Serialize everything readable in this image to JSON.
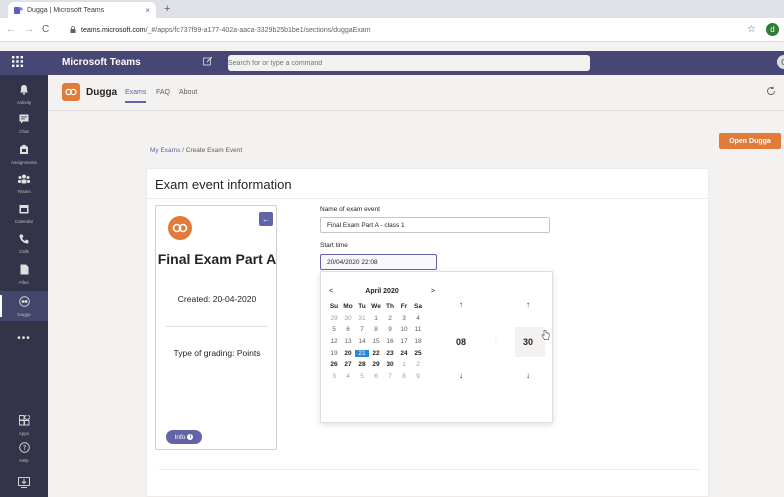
{
  "browser": {
    "tab_title": "Dugga | Microsoft Teams",
    "tab_close": "×",
    "new_tab": "+",
    "back": "←",
    "forward": "→",
    "reload": "C",
    "lock": "🔒",
    "url_host": "teams.microsoft.com",
    "url_path": "/_#/apps/fc737f99-a177-402a-aaca-3329b25b1be1/sections/duggaExam",
    "star": "☆",
    "profile_initial": "d"
  },
  "teams": {
    "app_name": "Microsoft Teams",
    "search_placeholder": "Search for or type a command",
    "user_initial": "C"
  },
  "rail": {
    "items": [
      {
        "label": "Activity",
        "icon": "bell-icon",
        "glyph": "🔔"
      },
      {
        "label": "Chat",
        "icon": "chat-icon",
        "glyph": "▤"
      },
      {
        "label": "Assignments",
        "icon": "assignments-icon",
        "glyph": "▦"
      },
      {
        "label": "Teams",
        "icon": "teams-icon",
        "glyph": "⁂"
      },
      {
        "label": "Calendar",
        "icon": "calendar-icon",
        "glyph": "▣"
      },
      {
        "label": "Calls",
        "icon": "phone-icon",
        "glyph": "✆"
      },
      {
        "label": "Files",
        "icon": "files-icon",
        "glyph": "▮"
      },
      {
        "label": "Dugga",
        "icon": "dugga-icon",
        "glyph": "◉"
      }
    ],
    "more": "•••",
    "apps_label": "Apps",
    "help_label": "Help"
  },
  "app": {
    "name": "Dugga",
    "tabs": [
      "Exams",
      "FAQ",
      "About"
    ],
    "open_button": "Open Dugga"
  },
  "breadcrumb": {
    "link": "My Exams",
    "separator": " / ",
    "current": "Create Exam Event"
  },
  "panel": {
    "title": "Exam event information"
  },
  "card": {
    "title": "Final Exam Part A",
    "created": "Created: 20-04-2020",
    "grading": "Type of grading: Points",
    "info_button": "Info",
    "back_glyph": "←"
  },
  "form": {
    "name_label": "Name of exam event",
    "name_value": "Final Exam Part A - class 1",
    "start_label": "Start time",
    "start_value": "20/04/2020 22:08"
  },
  "calendar": {
    "month": "April 2020",
    "prev": "<",
    "next": ">",
    "dow": [
      "Su",
      "Mo",
      "Tu",
      "We",
      "Th",
      "Fr",
      "Sa"
    ],
    "weeks": [
      [
        {
          "d": "29",
          "m": true
        },
        {
          "d": "30",
          "m": true
        },
        {
          "d": "31",
          "m": true
        },
        {
          "d": "1"
        },
        {
          "d": "2"
        },
        {
          "d": "3"
        },
        {
          "d": "4"
        }
      ],
      [
        {
          "d": "5"
        },
        {
          "d": "6"
        },
        {
          "d": "7"
        },
        {
          "d": "8"
        },
        {
          "d": "9"
        },
        {
          "d": "10"
        },
        {
          "d": "11"
        }
      ],
      [
        {
          "d": "12"
        },
        {
          "d": "13"
        },
        {
          "d": "14"
        },
        {
          "d": "15"
        },
        {
          "d": "16"
        },
        {
          "d": "17"
        },
        {
          "d": "18"
        }
      ],
      [
        {
          "d": "19"
        },
        {
          "d": "20",
          "b": true
        },
        {
          "d": "21",
          "s": true
        },
        {
          "d": "22",
          "b": true
        },
        {
          "d": "23",
          "b": true
        },
        {
          "d": "24",
          "b": true
        },
        {
          "d": "25",
          "b": true
        }
      ],
      [
        {
          "d": "26",
          "b": true
        },
        {
          "d": "27",
          "b": true
        },
        {
          "d": "28",
          "b": true
        },
        {
          "d": "29",
          "b": true
        },
        {
          "d": "30",
          "b": true
        },
        {
          "d": "1",
          "m": true
        },
        {
          "d": "2",
          "m": true
        }
      ],
      [
        {
          "d": "3",
          "m": true
        },
        {
          "d": "4",
          "m": true
        },
        {
          "d": "5",
          "m": true
        },
        {
          "d": "6",
          "m": true
        },
        {
          "d": "7",
          "m": true
        },
        {
          "d": "8",
          "m": true
        },
        {
          "d": "9",
          "m": true
        }
      ]
    ]
  },
  "time": {
    "hour": "08",
    "minute": "30",
    "separator": ":",
    "up": "↑",
    "down": "↓"
  },
  "colors": {
    "teams_purple": "#464775",
    "accent": "#6264a7",
    "dugga_orange": "#e07b3a",
    "selected_day": "#2b88d8"
  }
}
